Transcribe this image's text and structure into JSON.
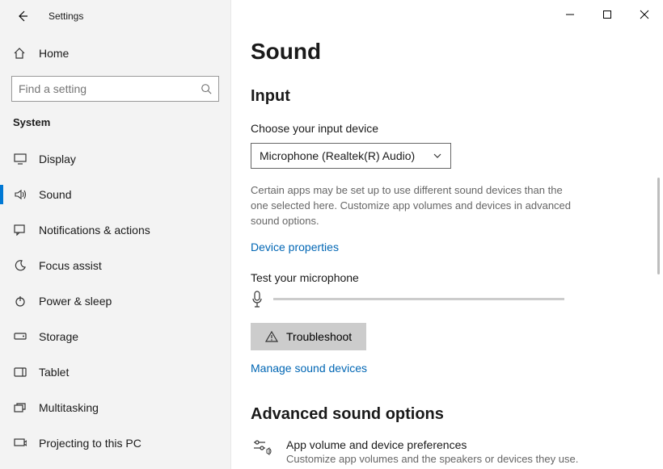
{
  "titlebar": {
    "title": "Settings"
  },
  "home": {
    "label": "Home"
  },
  "search": {
    "placeholder": "Find a setting"
  },
  "sidebar": {
    "section": "System",
    "items": [
      {
        "label": "Display"
      },
      {
        "label": "Sound"
      },
      {
        "label": "Notifications & actions"
      },
      {
        "label": "Focus assist"
      },
      {
        "label": "Power & sleep"
      },
      {
        "label": "Storage"
      },
      {
        "label": "Tablet"
      },
      {
        "label": "Multitasking"
      },
      {
        "label": "Projecting to this PC"
      }
    ]
  },
  "main": {
    "page_title": "Sound",
    "input_title": "Input",
    "choose_label": "Choose your input device",
    "input_device": "Microphone (Realtek(R) Audio)",
    "help_text": "Certain apps may be set up to use different sound devices than the one selected here. Customize app volumes and devices in advanced sound options.",
    "device_props_link": "Device properties",
    "test_label": "Test your microphone",
    "troubleshoot_label": "Troubleshoot",
    "manage_link": "Manage sound devices",
    "advanced_title": "Advanced sound options",
    "adv_item_title": "App volume and device preferences",
    "adv_item_desc": "Customize app volumes and the speakers or devices they use."
  }
}
